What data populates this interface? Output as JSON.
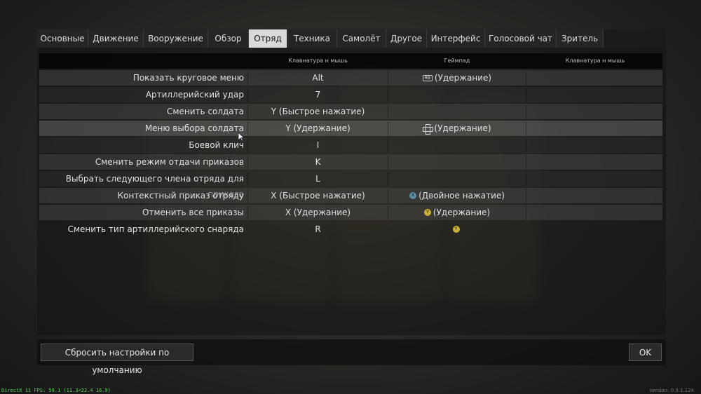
{
  "tabs": [
    {
      "label": "Основные",
      "active": false
    },
    {
      "label": "Движение",
      "active": false
    },
    {
      "label": "Вооружение",
      "active": false
    },
    {
      "label": "Обзор",
      "active": false
    },
    {
      "label": "Отряд",
      "active": true
    },
    {
      "label": "Техника",
      "active": false
    },
    {
      "label": "Самолёт",
      "active": false
    },
    {
      "label": "Другое",
      "active": false
    },
    {
      "label": "Интерфейс",
      "active": false
    },
    {
      "label": "Голосовой чат",
      "active": false
    },
    {
      "label": "Зритель",
      "active": false
    }
  ],
  "columns": {
    "keyboard": "Клавнатура н мышь",
    "gamepad": "Геймпад",
    "keyboard2": "Клавнатура н мышь"
  },
  "rows": [
    {
      "name": "Показать круговое меню",
      "kb": "Alt",
      "gp_icon": "rb-icon",
      "gp_icon_text": "RB",
      "gp": "(Удержание)"
    },
    {
      "name": "Артиллерийский удар",
      "kb": "7",
      "gp_icon": "",
      "gp_icon_text": "",
      "gp": ""
    },
    {
      "name": "Сменить солдата",
      "kb": "Y (Быстрое нажатие)",
      "gp_icon": "",
      "gp_icon_text": "",
      "gp": ""
    },
    {
      "name": "Меню выбора солдата",
      "kb": "Y (Удержание)",
      "gp_icon": "dpad-icon",
      "gp_icon_text": "",
      "gp": "(Удержание)"
    },
    {
      "name": "Боевой клич",
      "kb": "I",
      "gp_icon": "",
      "gp_icon_text": "",
      "gp": ""
    },
    {
      "name": "Сменить режим отдачи приказов",
      "kb": "K",
      "gp_icon": "",
      "gp_icon_text": "",
      "gp": ""
    },
    {
      "name": "Выбрать следующего члена отряда для приказа",
      "kb": "L",
      "gp_icon": "",
      "gp_icon_text": "",
      "gp": ""
    },
    {
      "name": "Контекстный приказ отряду",
      "kb": "X (Быстрое нажатие)",
      "gp_icon": "x-button-icon",
      "gp_icon_text": "X",
      "gp": "(Двойное нажатие)"
    },
    {
      "name": "Отменить все приказы",
      "kb": "X (Удержание)",
      "gp_icon": "y-button-icon",
      "gp_icon_text": "Y",
      "gp": "(Удержание)"
    },
    {
      "name": "Сменить тип артиллерийского снаряда",
      "kb": "R",
      "gp_icon": "y-button-icon",
      "gp_icon_text": "Y",
      "gp": ""
    }
  ],
  "footer": {
    "reset_label": "Сбросить настройки по умолчанию",
    "ok_label": "OK"
  },
  "fps_text": "DirectX 11 FPS: 59.1 (11.3<22.4 16.9)",
  "version_text": "version: 0.3.1.124",
  "colors": {
    "active_tab": "#d9d9d9",
    "x_button": "#5a8ea8",
    "y_button": "#c9b23b",
    "fps": "#5cd35c"
  }
}
